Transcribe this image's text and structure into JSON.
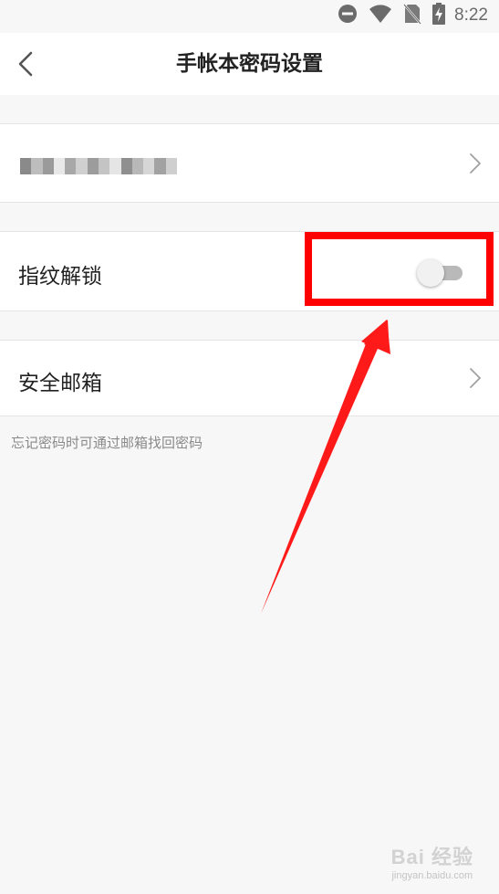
{
  "status_bar": {
    "time": "8:22",
    "icons": [
      "do-not-disturb-icon",
      "wifi-icon",
      "no-sim-icon",
      "battery-charging-icon"
    ]
  },
  "header": {
    "title": "手帐本密码设置",
    "back_icon": "chevron-left-icon"
  },
  "settings": {
    "password_row_obscured": true,
    "fingerprint": {
      "label": "指纹解锁",
      "enabled": false
    },
    "email": {
      "label": "安全邮箱",
      "hint": "忘记密码时可通过邮箱找回密码"
    }
  },
  "annotation": {
    "highlight_color": "#ff0000",
    "arrow_color": "#ff1a1a"
  },
  "watermark": {
    "main": "Bai 经验",
    "sub": "jingyan.baidu.com"
  },
  "colors": {
    "background": "#f7f7f7",
    "row_background": "#ffffff",
    "toggle_track_off": "#b9b9b9",
    "toggle_thumb_off": "#f1f1f1"
  }
}
